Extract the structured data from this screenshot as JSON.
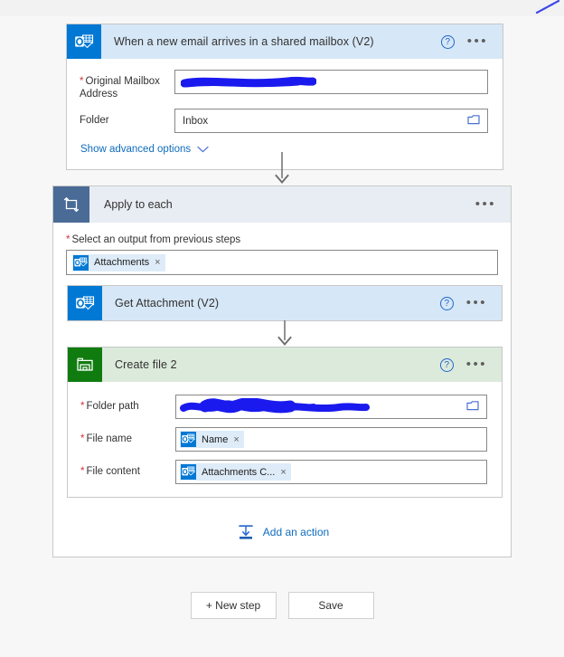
{
  "trigger": {
    "title": "When a new email arrives in a shared mailbox (V2)",
    "icon": "outlook-icon",
    "header_bg": "#d6e7f7",
    "icon_bg": "#0078d4",
    "help_label": "?",
    "more_label": "•••",
    "fields": [
      {
        "label": "Original Mailbox Address",
        "required": true,
        "value": "",
        "redacted": true
      },
      {
        "label": "Folder",
        "required": false,
        "value": "Inbox",
        "redacted": false,
        "picker_icon": "folder-icon"
      }
    ],
    "advanced_label": "Show advanced options",
    "advanced_chevron": "chevron-down-icon"
  },
  "loop": {
    "title": "Apply to each",
    "icon": "loop-icon",
    "header_bg": "#e8edf4",
    "icon_bg": "#4a6b96",
    "more_label": "•••",
    "select_label": "Select an output from previous steps",
    "select_required": true,
    "token": {
      "label": "Attachments",
      "icon": "outlook-icon",
      "remove_label": "×"
    },
    "add_action_label": "Add an action",
    "add_action_icon": "insert-step-icon"
  },
  "get_attachment": {
    "title": "Get Attachment (V2)",
    "icon": "outlook-icon",
    "header_bg": "#d6e7f7",
    "icon_bg": "#0078d4",
    "help_label": "?",
    "more_label": "•••"
  },
  "create_file": {
    "title": "Create file 2",
    "icon": "sharepoint-icon",
    "header_bg": "#dbeadb",
    "icon_bg": "#107c10",
    "help_label": "?",
    "more_label": "•••",
    "fields": [
      {
        "label": "Folder path",
        "required": true,
        "value": "",
        "redacted": true,
        "picker_icon": "folder-icon"
      },
      {
        "label": "File name",
        "required": true,
        "token": {
          "label": "Name",
          "icon": "outlook-icon",
          "remove_label": "×"
        }
      },
      {
        "label": "File content",
        "required": true,
        "token": {
          "label": "Attachments C...",
          "icon": "outlook-icon",
          "remove_label": "×"
        }
      }
    ]
  },
  "footer": {
    "new_step_label": "+ New step",
    "save_label": "Save"
  },
  "colors": {
    "accent_blue": "#0f6cbd",
    "outlook_blue": "#0078d4",
    "sharepoint_green": "#107c10",
    "required_red": "#d13438",
    "redaction_blue": "#1a1aee",
    "canvas_bg": "#f7f7f7"
  }
}
